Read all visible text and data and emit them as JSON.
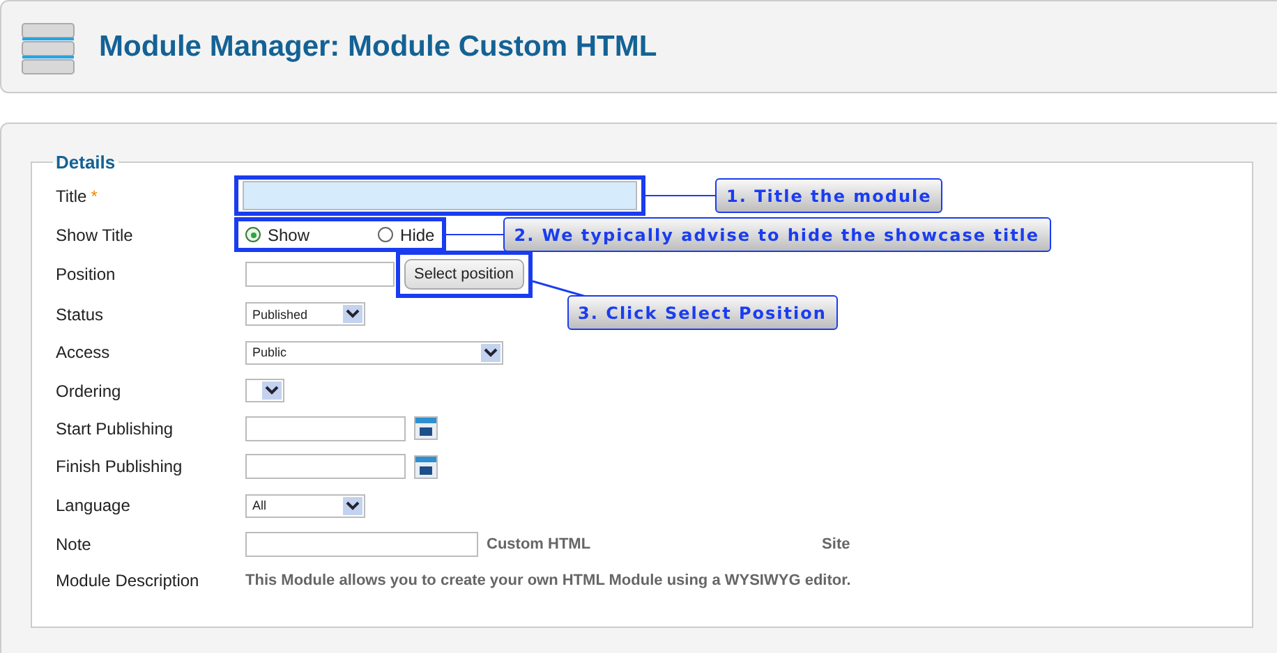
{
  "header": {
    "title": "Module Manager: Module Custom HTML"
  },
  "details": {
    "legend": "Details",
    "rows": [
      {
        "kind": "text",
        "label": "Title",
        "required_mark": "*",
        "highlighted": true,
        "callout": "1. Title the module"
      },
      {
        "kind": "radio",
        "label": "Show Title",
        "options": [
          {
            "label": "Show",
            "selected": true
          },
          {
            "label": "Hide",
            "selected": false
          }
        ],
        "callout": "2. We typically advise to hide the showcase title"
      },
      {
        "kind": "position",
        "label": "Position",
        "button": "Select position",
        "callout": "3. Click Select Position"
      },
      {
        "kind": "select",
        "label": "Status",
        "value": "Published"
      },
      {
        "kind": "select",
        "label": "Access",
        "value": "Public"
      },
      {
        "kind": "select",
        "label": "Ordering"
      },
      {
        "kind": "date",
        "label": "Start Publishing"
      },
      {
        "kind": "date",
        "label": "Finish Publishing"
      },
      {
        "kind": "select",
        "label": "Language",
        "value": "All"
      },
      {
        "kind": "note",
        "label": "Note",
        "type_text": "Custom HTML",
        "client_text": "Site"
      },
      {
        "kind": "description",
        "label": "Module Description",
        "text": "This Module allows you to create your own HTML Module using a WYSIWYG editor."
      }
    ]
  }
}
